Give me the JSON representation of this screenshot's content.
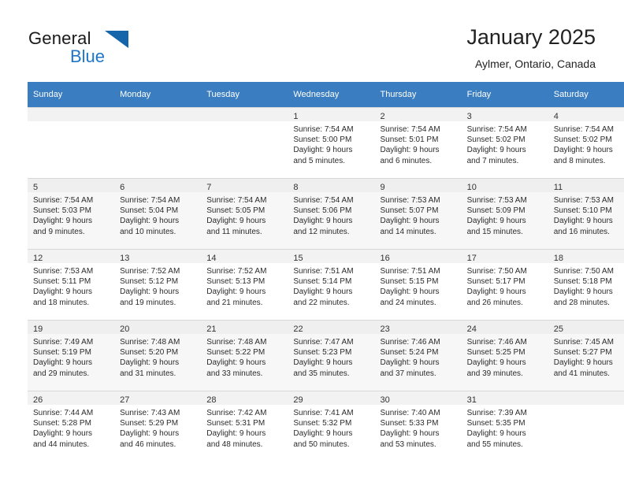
{
  "brand": {
    "word1": "General",
    "word2": "Blue",
    "logo_icon": "triangle-logo-icon",
    "accent_color": "#2076c6"
  },
  "header": {
    "title": "January 2025",
    "location": "Aylmer, Ontario, Canada"
  },
  "calendar": {
    "header_bg": "#3a7dc0",
    "weekdays": [
      "Sunday",
      "Monday",
      "Tuesday",
      "Wednesday",
      "Thursday",
      "Friday",
      "Saturday"
    ],
    "weeks": [
      [
        {
          "day": "",
          "lines": []
        },
        {
          "day": "",
          "lines": []
        },
        {
          "day": "",
          "lines": []
        },
        {
          "day": "1",
          "lines": [
            "Sunrise: 7:54 AM",
            "Sunset: 5:00 PM",
            "Daylight: 9 hours",
            "and 5 minutes."
          ]
        },
        {
          "day": "2",
          "lines": [
            "Sunrise: 7:54 AM",
            "Sunset: 5:01 PM",
            "Daylight: 9 hours",
            "and 6 minutes."
          ]
        },
        {
          "day": "3",
          "lines": [
            "Sunrise: 7:54 AM",
            "Sunset: 5:02 PM",
            "Daylight: 9 hours",
            "and 7 minutes."
          ]
        },
        {
          "day": "4",
          "lines": [
            "Sunrise: 7:54 AM",
            "Sunset: 5:02 PM",
            "Daylight: 9 hours",
            "and 8 minutes."
          ]
        }
      ],
      [
        {
          "day": "5",
          "lines": [
            "Sunrise: 7:54 AM",
            "Sunset: 5:03 PM",
            "Daylight: 9 hours",
            "and 9 minutes."
          ]
        },
        {
          "day": "6",
          "lines": [
            "Sunrise: 7:54 AM",
            "Sunset: 5:04 PM",
            "Daylight: 9 hours",
            "and 10 minutes."
          ]
        },
        {
          "day": "7",
          "lines": [
            "Sunrise: 7:54 AM",
            "Sunset: 5:05 PM",
            "Daylight: 9 hours",
            "and 11 minutes."
          ]
        },
        {
          "day": "8",
          "lines": [
            "Sunrise: 7:54 AM",
            "Sunset: 5:06 PM",
            "Daylight: 9 hours",
            "and 12 minutes."
          ]
        },
        {
          "day": "9",
          "lines": [
            "Sunrise: 7:53 AM",
            "Sunset: 5:07 PM",
            "Daylight: 9 hours",
            "and 14 minutes."
          ]
        },
        {
          "day": "10",
          "lines": [
            "Sunrise: 7:53 AM",
            "Sunset: 5:09 PM",
            "Daylight: 9 hours",
            "and 15 minutes."
          ]
        },
        {
          "day": "11",
          "lines": [
            "Sunrise: 7:53 AM",
            "Sunset: 5:10 PM",
            "Daylight: 9 hours",
            "and 16 minutes."
          ]
        }
      ],
      [
        {
          "day": "12",
          "lines": [
            "Sunrise: 7:53 AM",
            "Sunset: 5:11 PM",
            "Daylight: 9 hours",
            "and 18 minutes."
          ]
        },
        {
          "day": "13",
          "lines": [
            "Sunrise: 7:52 AM",
            "Sunset: 5:12 PM",
            "Daylight: 9 hours",
            "and 19 minutes."
          ]
        },
        {
          "day": "14",
          "lines": [
            "Sunrise: 7:52 AM",
            "Sunset: 5:13 PM",
            "Daylight: 9 hours",
            "and 21 minutes."
          ]
        },
        {
          "day": "15",
          "lines": [
            "Sunrise: 7:51 AM",
            "Sunset: 5:14 PM",
            "Daylight: 9 hours",
            "and 22 minutes."
          ]
        },
        {
          "day": "16",
          "lines": [
            "Sunrise: 7:51 AM",
            "Sunset: 5:15 PM",
            "Daylight: 9 hours",
            "and 24 minutes."
          ]
        },
        {
          "day": "17",
          "lines": [
            "Sunrise: 7:50 AM",
            "Sunset: 5:17 PM",
            "Daylight: 9 hours",
            "and 26 minutes."
          ]
        },
        {
          "day": "18",
          "lines": [
            "Sunrise: 7:50 AM",
            "Sunset: 5:18 PM",
            "Daylight: 9 hours",
            "and 28 minutes."
          ]
        }
      ],
      [
        {
          "day": "19",
          "lines": [
            "Sunrise: 7:49 AM",
            "Sunset: 5:19 PM",
            "Daylight: 9 hours",
            "and 29 minutes."
          ]
        },
        {
          "day": "20",
          "lines": [
            "Sunrise: 7:48 AM",
            "Sunset: 5:20 PM",
            "Daylight: 9 hours",
            "and 31 minutes."
          ]
        },
        {
          "day": "21",
          "lines": [
            "Sunrise: 7:48 AM",
            "Sunset: 5:22 PM",
            "Daylight: 9 hours",
            "and 33 minutes."
          ]
        },
        {
          "day": "22",
          "lines": [
            "Sunrise: 7:47 AM",
            "Sunset: 5:23 PM",
            "Daylight: 9 hours",
            "and 35 minutes."
          ]
        },
        {
          "day": "23",
          "lines": [
            "Sunrise: 7:46 AM",
            "Sunset: 5:24 PM",
            "Daylight: 9 hours",
            "and 37 minutes."
          ]
        },
        {
          "day": "24",
          "lines": [
            "Sunrise: 7:46 AM",
            "Sunset: 5:25 PM",
            "Daylight: 9 hours",
            "and 39 minutes."
          ]
        },
        {
          "day": "25",
          "lines": [
            "Sunrise: 7:45 AM",
            "Sunset: 5:27 PM",
            "Daylight: 9 hours",
            "and 41 minutes."
          ]
        }
      ],
      [
        {
          "day": "26",
          "lines": [
            "Sunrise: 7:44 AM",
            "Sunset: 5:28 PM",
            "Daylight: 9 hours",
            "and 44 minutes."
          ]
        },
        {
          "day": "27",
          "lines": [
            "Sunrise: 7:43 AM",
            "Sunset: 5:29 PM",
            "Daylight: 9 hours",
            "and 46 minutes."
          ]
        },
        {
          "day": "28",
          "lines": [
            "Sunrise: 7:42 AM",
            "Sunset: 5:31 PM",
            "Daylight: 9 hours",
            "and 48 minutes."
          ]
        },
        {
          "day": "29",
          "lines": [
            "Sunrise: 7:41 AM",
            "Sunset: 5:32 PM",
            "Daylight: 9 hours",
            "and 50 minutes."
          ]
        },
        {
          "day": "30",
          "lines": [
            "Sunrise: 7:40 AM",
            "Sunset: 5:33 PM",
            "Daylight: 9 hours",
            "and 53 minutes."
          ]
        },
        {
          "day": "31",
          "lines": [
            "Sunrise: 7:39 AM",
            "Sunset: 5:35 PM",
            "Daylight: 9 hours",
            "and 55 minutes."
          ]
        },
        {
          "day": "",
          "lines": []
        }
      ]
    ]
  }
}
